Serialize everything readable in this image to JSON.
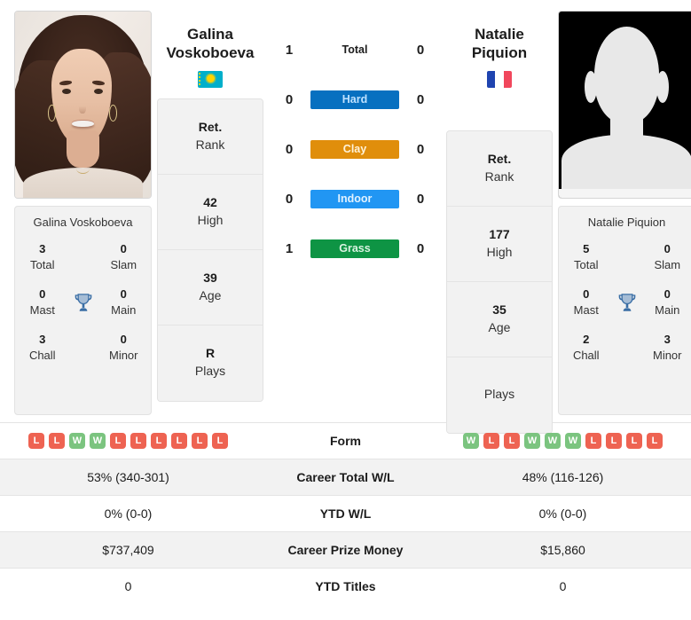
{
  "players": {
    "left": {
      "first_name": "Galina",
      "last_name": "Voskoboeva",
      "full_name": "Galina Voskoboeva",
      "flag": "kazakhstan-flag",
      "photo": "player-portrait-photo",
      "rank_card": [
        {
          "value": "Ret.",
          "label": "Rank"
        },
        {
          "value": "42",
          "label": "High"
        },
        {
          "value": "39",
          "label": "Age"
        },
        {
          "value": "R",
          "label": "Plays"
        }
      ],
      "titles": [
        {
          "value": "3",
          "label": "Total"
        },
        {
          "value": "0",
          "label": "Slam"
        },
        {
          "value": "0",
          "label": "Mast"
        },
        {
          "value": "0",
          "label": "Main"
        },
        {
          "value": "3",
          "label": "Chall"
        },
        {
          "value": "0",
          "label": "Minor"
        }
      ],
      "form": [
        "L",
        "L",
        "W",
        "W",
        "L",
        "L",
        "L",
        "L",
        "L",
        "L"
      ],
      "career_total_wl": "53% (340-301)",
      "ytd_wl": "0% (0-0)",
      "career_prize_money": "$737,409",
      "ytd_titles": "0"
    },
    "right": {
      "first_name": "Natalie",
      "last_name": "Piquion",
      "full_name": "Natalie Piquion",
      "flag": "france-flag",
      "photo": "player-placeholder-silhouette",
      "rank_card": [
        {
          "value": "Ret.",
          "label": "Rank"
        },
        {
          "value": "177",
          "label": "High"
        },
        {
          "value": "35",
          "label": "Age"
        },
        {
          "value": "",
          "label": "Plays"
        }
      ],
      "titles": [
        {
          "value": "5",
          "label": "Total"
        },
        {
          "value": "0",
          "label": "Slam"
        },
        {
          "value": "0",
          "label": "Mast"
        },
        {
          "value": "0",
          "label": "Main"
        },
        {
          "value": "2",
          "label": "Chall"
        },
        {
          "value": "3",
          "label": "Minor"
        }
      ],
      "form": [
        "W",
        "L",
        "L",
        "W",
        "W",
        "W",
        "L",
        "L",
        "L",
        "L"
      ],
      "career_total_wl": "48% (116-126)",
      "ytd_wl": "0% (0-0)",
      "career_prize_money": "$15,860",
      "ytd_titles": "0"
    }
  },
  "head_to_head": [
    {
      "surface": "Total",
      "style": "plain",
      "left": "1",
      "right": "0"
    },
    {
      "surface": "Hard",
      "style": "hard",
      "left": "0",
      "right": "0"
    },
    {
      "surface": "Clay",
      "style": "clay",
      "left": "0",
      "right": "0"
    },
    {
      "surface": "Indoor",
      "style": "indoor",
      "left": "0",
      "right": "0"
    },
    {
      "surface": "Grass",
      "style": "grass",
      "left": "1",
      "right": "0"
    }
  ],
  "table": {
    "rows": [
      {
        "label": "Form",
        "key": "form"
      },
      {
        "label": "Career Total W/L",
        "key": "career_total_wl"
      },
      {
        "label": "YTD W/L",
        "key": "ytd_wl"
      },
      {
        "label": "Career Prize Money",
        "key": "career_prize_money"
      },
      {
        "label": "YTD Titles",
        "key": "ytd_titles"
      }
    ]
  },
  "colors": {
    "hard": "#0770C0",
    "clay": "#E08E0B",
    "indoor": "#2196F3",
    "grass": "#0E9444",
    "win": "#7BC47F",
    "loss": "#EE6352",
    "trophy": "#3A6EA5",
    "row_shade": "#f2f2f2"
  },
  "icons": {
    "trophy": "trophy-icon"
  }
}
